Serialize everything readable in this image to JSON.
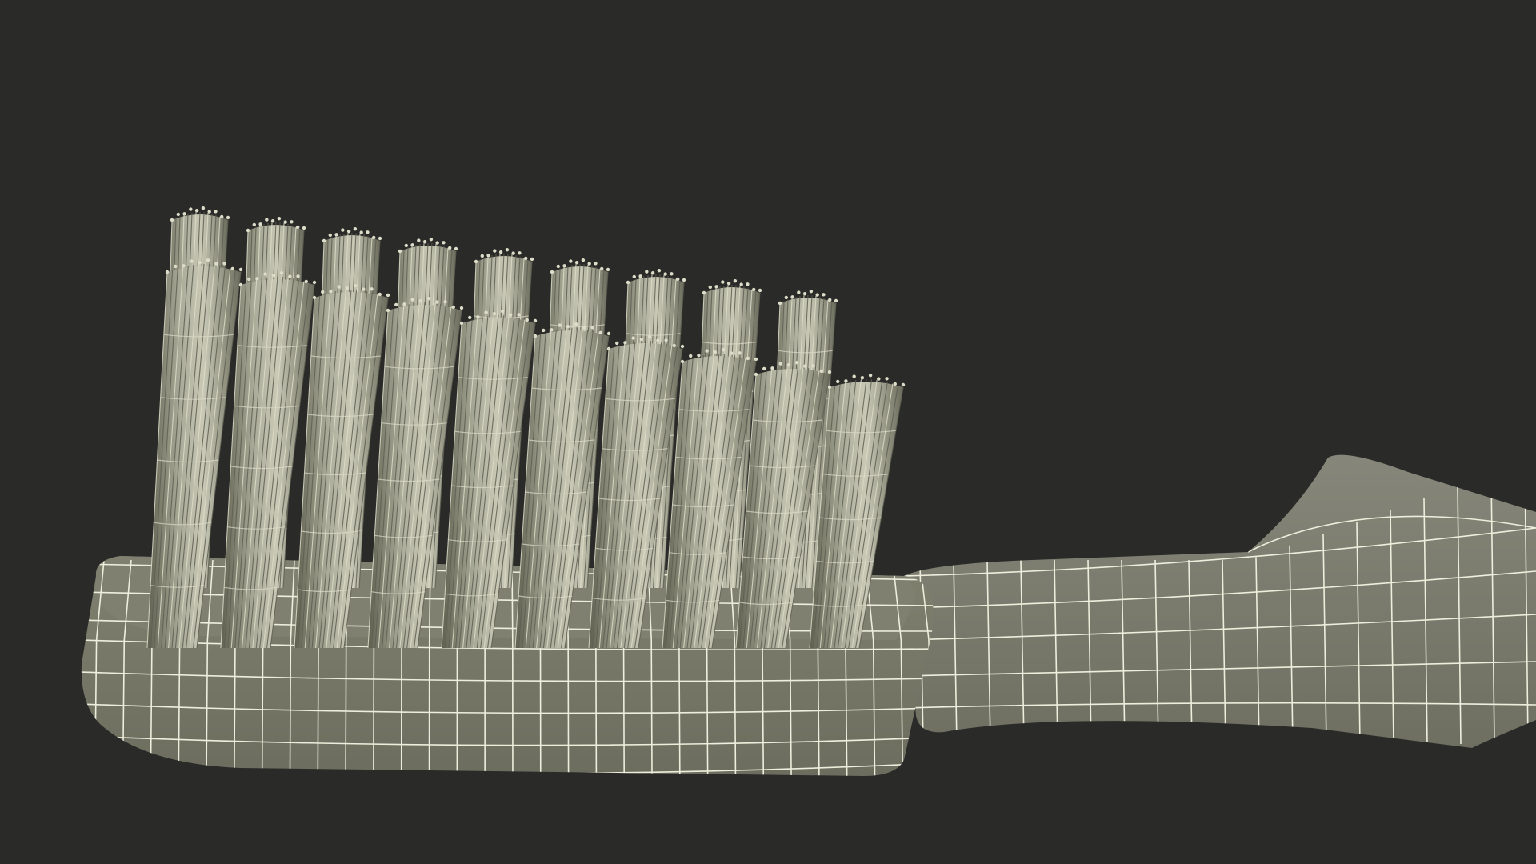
{
  "scene": {
    "subject": "toothbrush-head-wireframe",
    "render_style": "wireframe-over-shaded",
    "colors": {
      "background": "#2a2a29",
      "body_fill": "#7a7b6b",
      "body_fill_shadow": "#6a6b5c",
      "wire": "#eeeedc",
      "bristle_fill": "#8d8e7e",
      "bristle_light": "#dcdcc8",
      "bristle_dark": "#5e5f52"
    },
    "tuft_rows": [
      {
        "row": "back",
        "count": 9
      },
      {
        "row": "front",
        "count": 10
      }
    ]
  }
}
